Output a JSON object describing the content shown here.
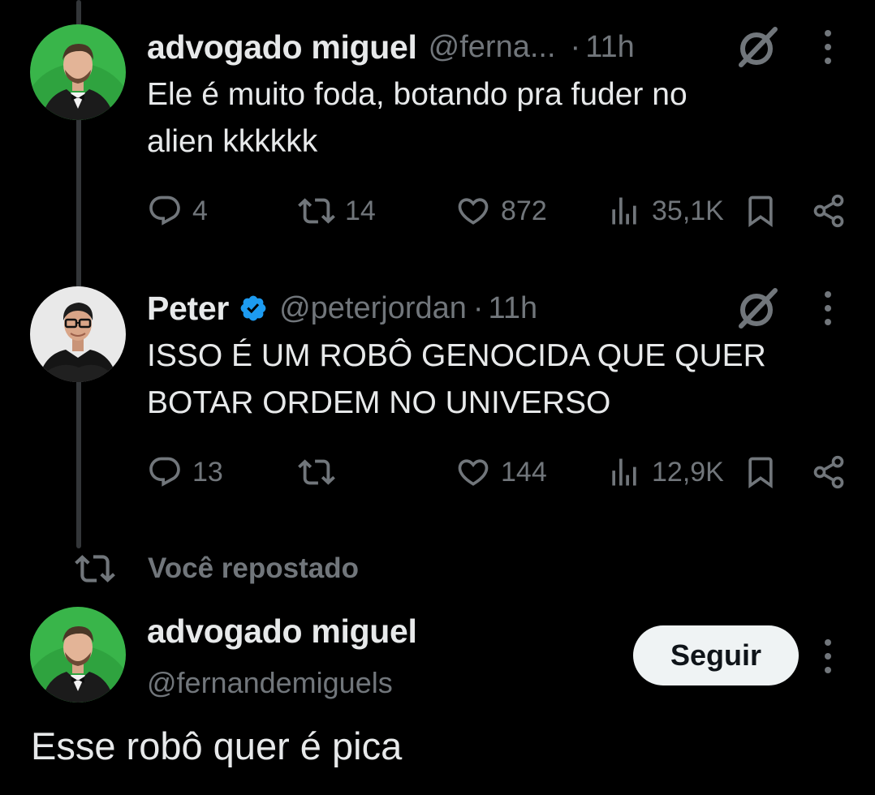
{
  "tweets": [
    {
      "display_name": "advogado miguel",
      "handle": "@ferna...",
      "separator": "·",
      "time": "11h",
      "text_lines": [
        "Ele é muito foda, botando pra fuder no",
        "alien kkkkkk"
      ],
      "avatar": "avatar-green-background-bowtie",
      "verified": false,
      "stats": {
        "replies": "4",
        "reposts": "14",
        "likes": "872",
        "views": "35,1K"
      }
    },
    {
      "display_name": "Peter",
      "handle": "@peterjordan",
      "separator": "·",
      "time": "11h",
      "text_lines": [
        "ISSO É UM ROBÔ GENOCIDA QUE QUER",
        "BOTAR ORDEM NO UNIVERSO"
      ],
      "avatar": "avatar-glasses-black-shirt",
      "verified": true,
      "stats": {
        "replies": "13",
        "reposts": "",
        "likes": "144",
        "views": "12,9K"
      }
    }
  ],
  "repost_banner": {
    "label": "Você repostado"
  },
  "main_post": {
    "display_name": "advogado miguel",
    "handle": "@fernandemiguels",
    "follow_label": "Seguir",
    "text": "Esse robô quer é pica"
  },
  "colors": {
    "background": "#000000",
    "text_primary": "#e7e9ea",
    "text_secondary": "#71767b",
    "verified_blue": "#1d9bf0",
    "follow_button_bg": "#eff3f4"
  },
  "icons": [
    "reply-icon",
    "repost-icon",
    "like-icon",
    "views-icon",
    "bookmark-icon",
    "share-icon",
    "grok-icon",
    "more-icon",
    "verified-badge-icon"
  ]
}
